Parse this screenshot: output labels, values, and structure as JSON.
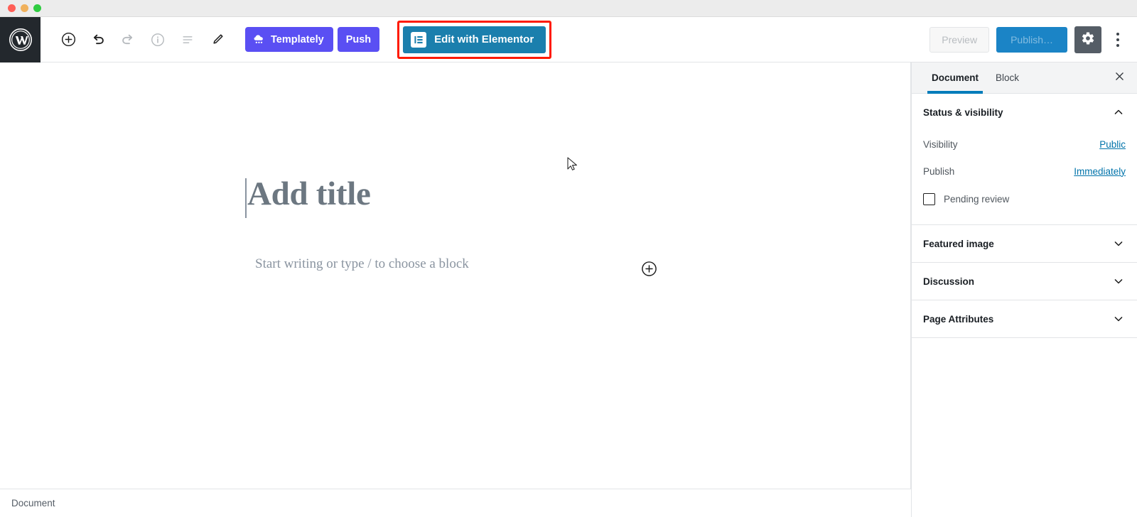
{
  "window": {
    "traffic_lights": [
      "close",
      "minimize",
      "maximize"
    ]
  },
  "header": {
    "logo_name": "wordpress-logo",
    "tools": [
      {
        "name": "add-block-icon",
        "label": "Add block",
        "enabled": true
      },
      {
        "name": "undo-icon",
        "label": "Undo",
        "enabled": true
      },
      {
        "name": "redo-icon",
        "label": "Redo",
        "enabled": false
      },
      {
        "name": "info-icon",
        "label": "Content structure",
        "enabled": false
      },
      {
        "name": "list-view-icon",
        "label": "Block navigation",
        "enabled": false
      },
      {
        "name": "pencil-icon",
        "label": "Edit",
        "enabled": true
      }
    ],
    "templately_label": "Templately",
    "push_label": "Push",
    "elementor_label": "Edit with Elementor",
    "preview_label": "Preview",
    "publish_label": "Publish…",
    "settings_label": "Settings",
    "more_label": "More tools & options",
    "highlight_color": "#ff1a00",
    "templately_color": "#5a4ff3",
    "elementor_color": "#1b7fad",
    "publish_color": "#1b84c6",
    "gear_color": "#555d66"
  },
  "editor": {
    "title_placeholder": "Add title",
    "paragraph_placeholder": "Start writing or type / to choose a block",
    "inserter_name": "block-inserter-icon"
  },
  "footer": {
    "breadcrumb": "Document"
  },
  "sidebar": {
    "tabs": [
      {
        "label": "Document",
        "active": true
      },
      {
        "label": "Block",
        "active": false
      }
    ],
    "close_label": "Close settings",
    "active_accent": "#007cba",
    "panels": [
      {
        "title": "Status & visibility",
        "expanded": true,
        "rows": [
          {
            "label": "Visibility",
            "value": "Public"
          },
          {
            "label": "Publish",
            "value": "Immediately"
          }
        ],
        "checkbox": {
          "label": "Pending review",
          "checked": false
        }
      },
      {
        "title": "Featured image",
        "expanded": false
      },
      {
        "title": "Discussion",
        "expanded": false
      },
      {
        "title": "Page Attributes",
        "expanded": false
      }
    ]
  }
}
